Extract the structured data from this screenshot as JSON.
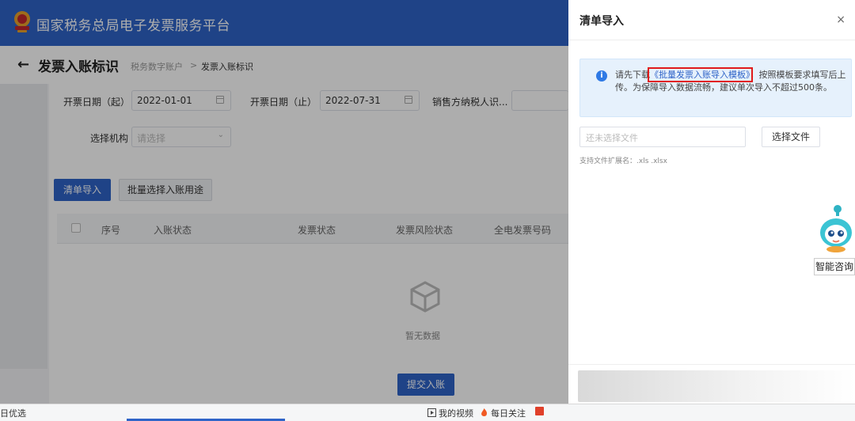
{
  "app": {
    "title": "国家税务总局电子发票服务平台"
  },
  "header": {
    "back_icon": "←",
    "page_title": "发票入账标识",
    "breadcrumb": [
      "税务数字账户",
      "发票入账标识"
    ],
    "breadcrumb_sep": ">"
  },
  "filters": {
    "start_label": "开票日期（起）",
    "start_value": "2022-01-01",
    "end_label": "开票日期（止）",
    "end_value": "2022-07-31",
    "seller_label": "销售方纳税人识...",
    "org_label": "选择机构",
    "org_placeholder": "请选择"
  },
  "actions": {
    "import_label": "清单导入",
    "batch_label": "批量选择入账用途"
  },
  "table": {
    "columns": [
      "序号",
      "入账状态",
      "发票状态",
      "发票风险状态",
      "全电发票号码"
    ],
    "empty_text": "暂无数据"
  },
  "submit_label": "提交入账",
  "drawer": {
    "title": "清单导入",
    "close_icon": "×",
    "notice": {
      "before": "请先下载",
      "link": "《批量发票入账导入模板》",
      "after": "，按照模板要求填写后上传。为保障导入数据流畅，建议单次导入不超过500条。"
    },
    "file_placeholder": "还未选择文件",
    "choose_file_label": "选择文件",
    "file_hint": "支持文件扩展名：.xls .xlsx"
  },
  "assistant": {
    "label": "智能咨询"
  },
  "taskbar": {
    "left_text": "日优选",
    "items": [
      "我的视频",
      "每日关注"
    ]
  },
  "colors": {
    "brand": "#2f64c8",
    "highlight": "#e11a1a"
  }
}
